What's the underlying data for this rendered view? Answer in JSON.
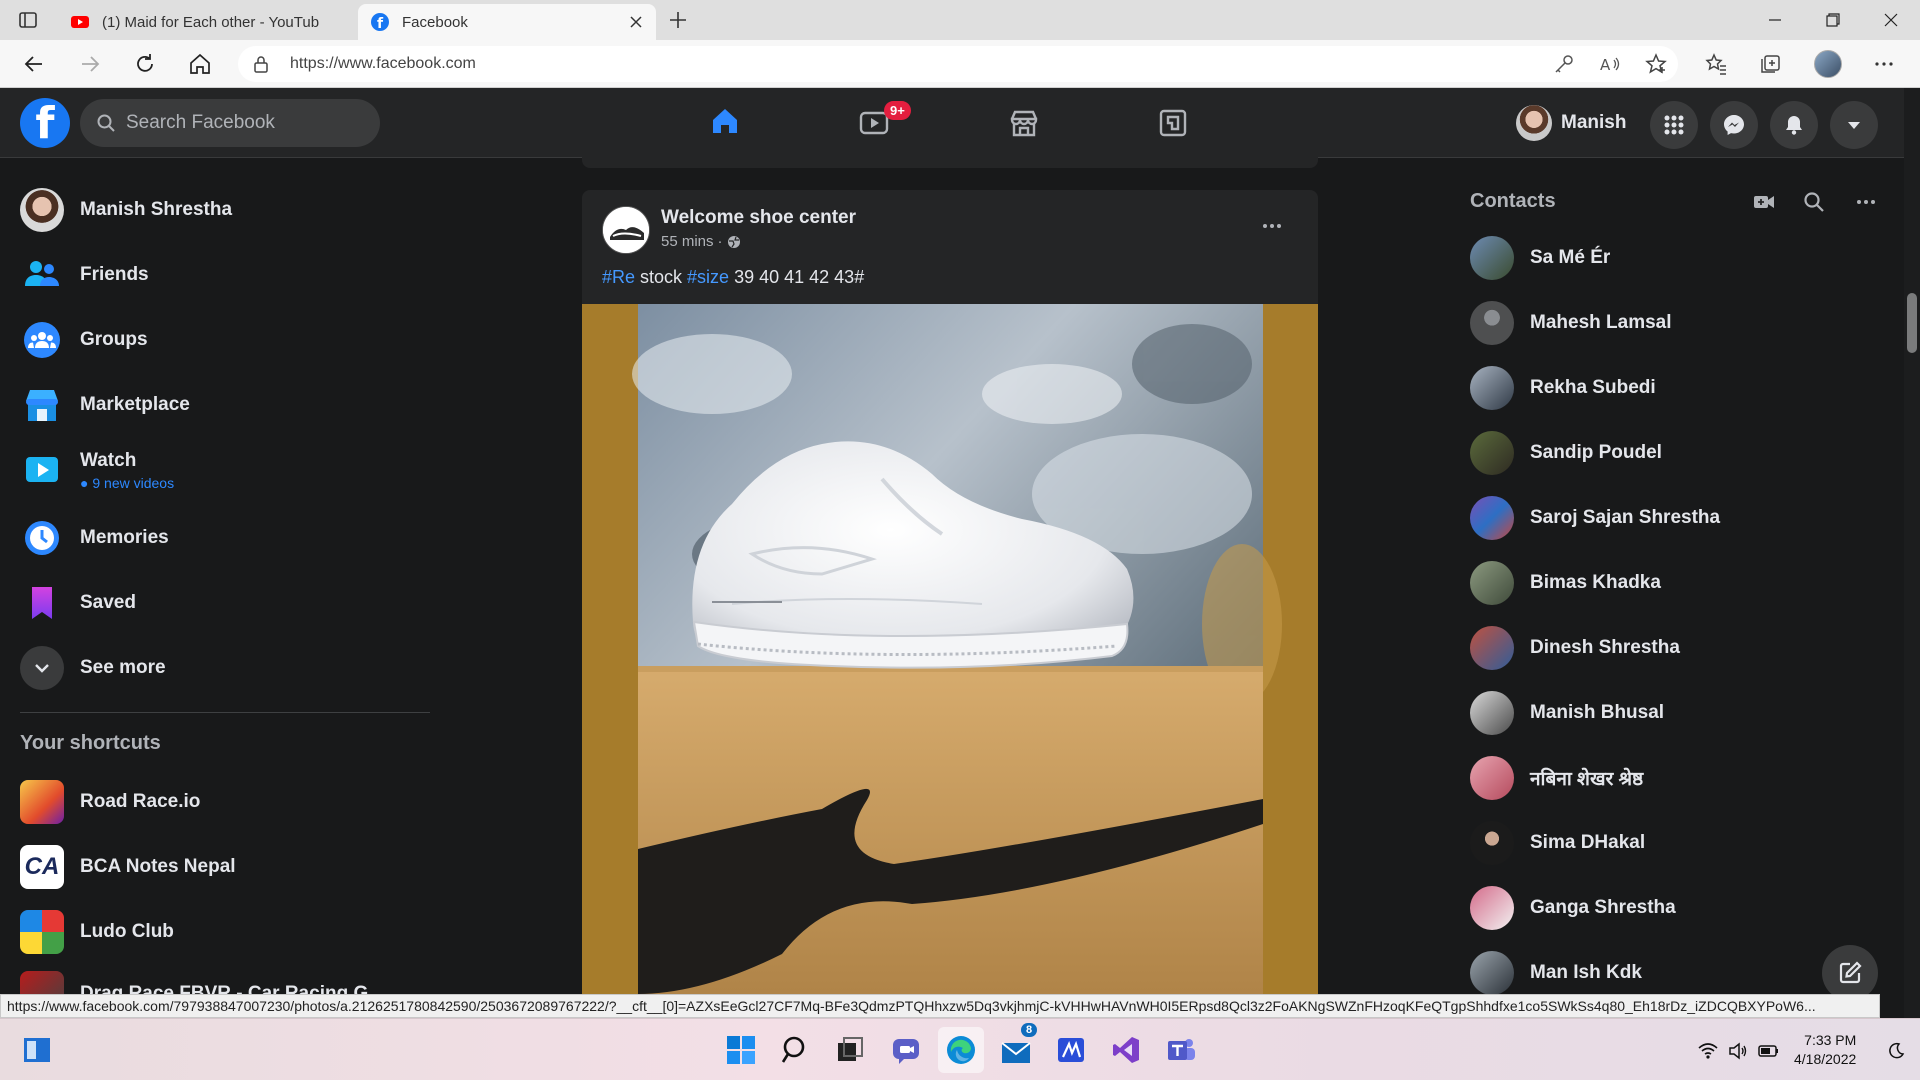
{
  "browser": {
    "tabs": [
      {
        "title": "(1) Maid for Each other - YouTub",
        "favicon": "youtube-icon",
        "active": false
      },
      {
        "title": "Facebook",
        "favicon": "facebook-icon",
        "active": true
      }
    ],
    "url": "https://www.facebook.com",
    "status_url": "https://www.facebook.com/797938847007230/photos/a.2126251780842590/2503672089767222/?__cft__[0]=AZXsEeGcl27CF7Mq-BFe3QdmzPTQHhxzw5Dq3vkjhmjC-kVHHwHAVnWH0I5ERpsd8Qcl3z2FoAKNgSWZnFHzoqKFeQTgpShhdfxe1co5SWkSs4q80_Eh18rDz_iZDCQBXYPoW6..."
  },
  "header": {
    "search_placeholder": "Search Facebook",
    "watch_badge": "9+",
    "profile_name": "Manish",
    "accent": "#2d88ff"
  },
  "sidebar": {
    "profile": "Manish Shrestha",
    "items": [
      {
        "label": "Friends",
        "icon": "friends-icon"
      },
      {
        "label": "Groups",
        "icon": "groups-icon"
      },
      {
        "label": "Marketplace",
        "icon": "marketplace-icon"
      },
      {
        "label": "Watch",
        "icon": "watch-icon",
        "sub": "9 new videos"
      },
      {
        "label": "Memories",
        "icon": "memories-icon"
      },
      {
        "label": "Saved",
        "icon": "saved-icon"
      },
      {
        "label": "See more",
        "icon": "chevron-down-icon"
      }
    ],
    "shortcuts_title": "Your shortcuts",
    "shortcuts": [
      "Road Race.io",
      "BCA Notes Nepal",
      "Ludo Club",
      "Drag Race FBVR - Car Racing G"
    ]
  },
  "post": {
    "author": "Welcome shoe center",
    "time": "55 mins",
    "time_sep": " · ",
    "tag1": "#Re",
    "text1": " stock ",
    "tag2": "#size",
    "text2": " 39 40 41 42 43#"
  },
  "contacts": {
    "title": "Contacts",
    "people": [
      "Sa Mé Ér",
      "Mahesh Lamsal",
      "Rekha Subedi",
      "Sandip Poudel",
      "Saroj Sajan Shrestha",
      "Bimas Khadka",
      "Dinesh Shrestha",
      "Manish Bhusal",
      "नबिना शेखर श्रेष्ठ",
      "Sima DHakal",
      "Ganga Shrestha",
      "Man Ish Kdk"
    ]
  },
  "taskbar": {
    "time": "7:33 PM",
    "date": "4/18/2022",
    "mail_badge": "8"
  }
}
